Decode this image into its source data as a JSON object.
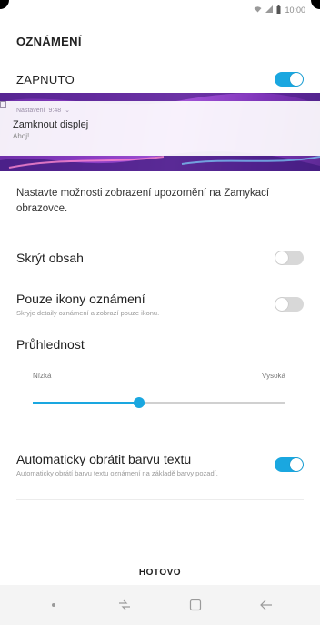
{
  "status_bar": {
    "time": "10:00",
    "icons": [
      "wifi-icon",
      "signal-icon",
      "battery-icon"
    ]
  },
  "page": {
    "title": "OZNÁMENÍ",
    "enabled_label": "ZAPNUTO",
    "enabled": true
  },
  "preview": {
    "meta_app": "Nastavení",
    "meta_time": "9:48",
    "title": "Zamknout displej",
    "text": "Ahoj!",
    "colors": {
      "gradient_start": "#6b2ea6",
      "gradient_end": "#5e2a96"
    }
  },
  "description": "Nastavte možnosti zobrazení upozornění na Zamykací obrazovce.",
  "settings": {
    "hide_content": {
      "label": "Skrýt obsah",
      "enabled": false
    },
    "icons_only": {
      "label": "Pouze ikony oznámení",
      "sublabel": "Skryje detaily oznámení a zobrazí pouze ikonu.",
      "enabled": false
    },
    "transparency": {
      "label": "Průhlednost",
      "min_label": "Nízká",
      "max_label": "Vysoká",
      "value": 0.42
    },
    "auto_invert": {
      "label": "Automaticky obrátit barvu textu",
      "sublabel": "Automaticky obrátí barvu textu oznámení na základě barvy pozadí.",
      "enabled": true
    }
  },
  "footer": {
    "done_label": "HOTOVO"
  },
  "nav_bar": [
    "dot-icon",
    "recents-icon",
    "home-icon",
    "back-icon"
  ],
  "colors": {
    "accent": "#1aa7e0",
    "toggle_off": "#d8d8d8"
  }
}
